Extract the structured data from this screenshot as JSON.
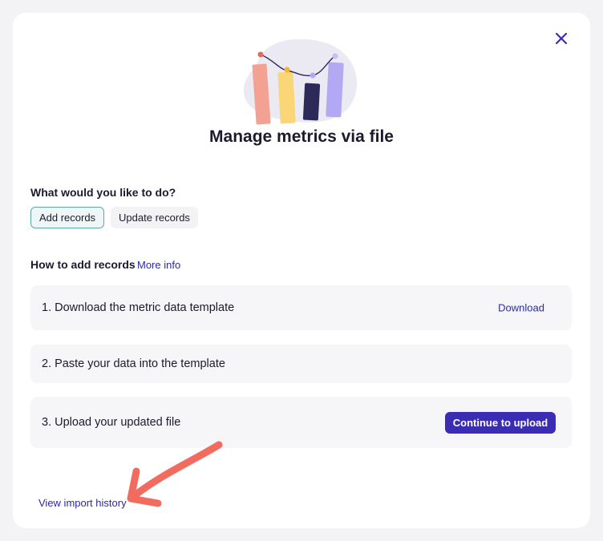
{
  "dialog": {
    "title": "Manage metrics via file",
    "close_icon": "close-icon"
  },
  "action": {
    "question": "What would you like to do?",
    "options": [
      {
        "label": "Add records",
        "selected": true
      },
      {
        "label": "Update records",
        "selected": false
      }
    ]
  },
  "steps": {
    "heading": "How to add records",
    "more_info_label": "More info",
    "items": [
      {
        "label": "1. Download the metric data template",
        "action_label": "Download"
      },
      {
        "label": "2. Paste your data into the template"
      },
      {
        "label": "3. Upload your updated file",
        "action_label": "Continue to upload"
      }
    ]
  },
  "footer": {
    "history_label": "View import history"
  },
  "colors": {
    "accent": "#3a2db3",
    "link": "#2a2aa8",
    "selected_border": "#5aa9a6",
    "annotation_arrow": "#f26b5f"
  }
}
